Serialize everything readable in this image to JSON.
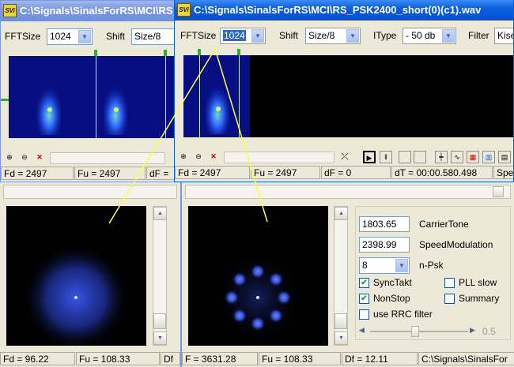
{
  "app_icon": "SVi",
  "win_back": {
    "title": "C:\\Signals\\SinalsForRS\\MCI\\RS_",
    "fft_label": "FFTSize",
    "fft_value": "1024",
    "shift_label": "Shift",
    "shift_value": "Size/8",
    "status_fd": "Fd = 2497",
    "status_fu": "Fu = 2497",
    "status_df": "dF ="
  },
  "win_front": {
    "title": "C:\\Signals\\SinalsForRS\\MCI\\RS_PSK2400_short(0)(c1).wav",
    "fft_label": "FFTSize",
    "fft_value": "1024",
    "shift_label": "Shift",
    "shift_value": "Size/8",
    "itype_label": "IType",
    "itype_value": "- 50 db",
    "filter_label": "Filter",
    "filter_value": "Kise",
    "status_fd": "Fd = 2497",
    "status_fu": "Fu = 2497",
    "status_df": "dF = 0",
    "status_dt": "dT = 00:00.580.498",
    "status_spe": "Spe"
  },
  "left_panel": {
    "status_fd": "Fd = 96.22",
    "status_fu": "Fu = 108.33",
    "status_df": "Df"
  },
  "right_panel": {
    "carrier_value": "1803.65",
    "carrier_label": "CarrierTone",
    "speed_value": "2398.99",
    "speed_label": "SpeedModulation",
    "npsk_value": "8",
    "npsk_label": "n-Psk",
    "synctakt_label": "SyncTakt",
    "synctakt_checked": "✔",
    "pll_label": "PLL slow",
    "pll_checked": "",
    "nonstop_label": "NonStop",
    "nonstop_checked": "✔",
    "summary_label": "Summary",
    "summary_checked": "",
    "rrc_label": "use RRC filter",
    "rrc_checked": "",
    "slider_value": "0.5",
    "status_f": "F = 3631.28",
    "status_fu": "Fu = 108.33",
    "status_df": "Df = 12.11",
    "status_path": "C:\\Signals\\SinalsFor"
  },
  "colors": {
    "accent": "#0a5fde",
    "scope_point": "#3f5fff",
    "spectrum_bg": "#00006e"
  }
}
